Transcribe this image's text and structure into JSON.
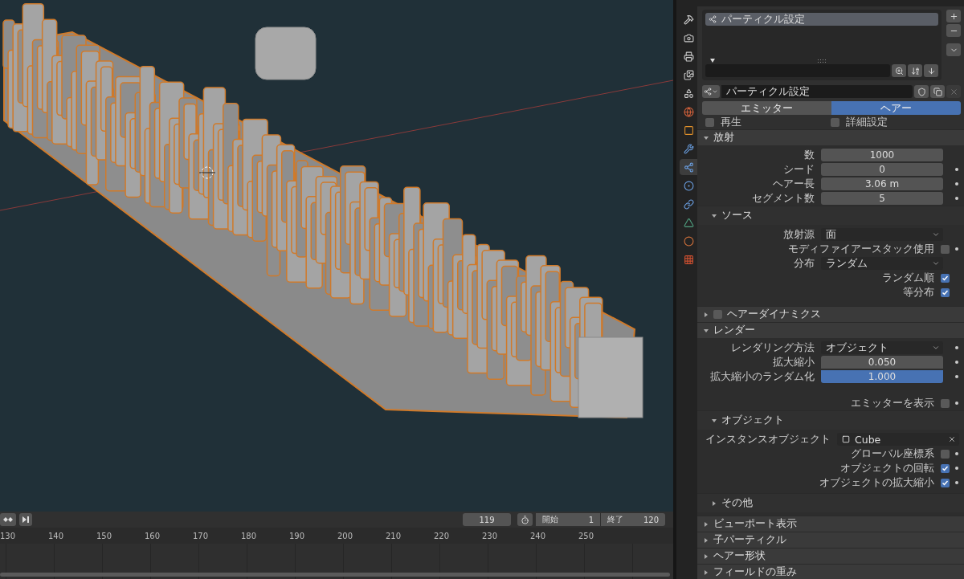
{
  "timeline": {
    "current_frame": "119",
    "start": {
      "label": "開始",
      "value": "1"
    },
    "end": {
      "label": "終了",
      "value": "120"
    },
    "ruler": [
      "130",
      "140",
      "150",
      "160",
      "170",
      "180",
      "190",
      "200",
      "210",
      "220",
      "230",
      "240",
      "250"
    ]
  },
  "properties_tabs": [
    {
      "kind": "tool",
      "selected": false
    },
    {
      "kind": "render",
      "selected": false
    },
    {
      "kind": "output",
      "selected": false
    },
    {
      "kind": "view_layer",
      "selected": false
    },
    {
      "kind": "scene",
      "selected": false
    },
    {
      "kind": "world",
      "selected": false
    },
    {
      "kind": "object",
      "selected": false
    },
    {
      "kind": "modifier",
      "selected": false
    },
    {
      "kind": "particles",
      "selected": true
    },
    {
      "kind": "physics",
      "selected": false
    },
    {
      "kind": "constraints",
      "selected": false
    },
    {
      "kind": "data",
      "selected": false
    },
    {
      "kind": "material",
      "selected": false
    },
    {
      "kind": "texture",
      "selected": false
    }
  ],
  "particle_list": {
    "items": [
      {
        "name": "パーティクル設定",
        "selected": true
      }
    ]
  },
  "datablock": {
    "name": "パーティクル設定"
  },
  "type_tabs": [
    {
      "label": "エミッター",
      "selected": false
    },
    {
      "label": "ヘアー",
      "selected": true
    }
  ],
  "toggles": [
    {
      "label": "再生",
      "checked": false
    },
    {
      "label": "詳細設定",
      "checked": false
    }
  ],
  "panels": [
    {
      "title": "放射",
      "expanded": true,
      "rows": [
        {
          "kind": "number",
          "label": "数",
          "value": "1000",
          "active": false,
          "animatable": false
        },
        {
          "kind": "number",
          "label": "シード",
          "value": "0",
          "active": false,
          "animatable": true
        },
        {
          "kind": "number",
          "label": "ヘアー長",
          "value": "3.06 m",
          "active": false,
          "animatable": true
        },
        {
          "kind": "number",
          "label": "セグメント数",
          "value": "5",
          "active": false,
          "animatable": true
        },
        {
          "kind": "subpanel",
          "title": "ソース",
          "expanded": true,
          "rows": [
            {
              "kind": "dropdown",
              "label": "放射源",
              "value": "面",
              "animatable": false
            },
            {
              "kind": "checkbox",
              "label": "モディファイアースタック使用",
              "checked": false,
              "animatable": true
            },
            {
              "kind": "dropdown",
              "label": "分布",
              "value": "ランダム",
              "animatable": false
            },
            {
              "kind": "checkbox",
              "label": "ランダム順",
              "checked": true,
              "animatable": false
            },
            {
              "kind": "checkbox",
              "label": "等分布",
              "checked": true,
              "animatable": false
            }
          ]
        }
      ]
    },
    {
      "title": "ヘアーダイナミクス",
      "expanded": false,
      "toggle": {
        "checked": false
      }
    },
    {
      "title": "レンダー",
      "expanded": true,
      "rows": [
        {
          "kind": "dropdown",
          "label": "レンダリング方法",
          "value": "オブジェクト",
          "animatable": true
        },
        {
          "kind": "number_group",
          "fields": [
            {
              "label": "拡大縮小",
              "value": "0.050",
              "active": false,
              "animatable": true
            },
            {
              "label": "拡大縮小のランダム化",
              "value": "1.000",
              "active": true,
              "animatable": true
            }
          ]
        },
        {
          "kind": "spacer"
        },
        {
          "kind": "checkbox",
          "label": "エミッターを表示",
          "checked": false,
          "animatable": true
        },
        {
          "kind": "subpanel",
          "title": "オブジェクト",
          "expanded": true,
          "rows": [
            {
              "kind": "object",
              "label": "インスタンスオブジェクト",
              "value": "Cube",
              "animatable": false
            },
            {
              "kind": "checkbox",
              "label": "グローバル座標系",
              "checked": false,
              "animatable": true
            },
            {
              "kind": "checkbox",
              "label": "オブジェクトの回転",
              "checked": true,
              "animatable": true
            },
            {
              "kind": "checkbox",
              "label": "オブジェクトの拡大縮小",
              "checked": true,
              "animatable": true
            }
          ]
        },
        {
          "kind": "subpanel",
          "title": "その他",
          "expanded": false
        }
      ]
    },
    {
      "title": "ビューポート表示",
      "expanded": false
    },
    {
      "title": "子パーティクル",
      "expanded": false
    },
    {
      "title": "ヘアー形状",
      "expanded": false
    },
    {
      "title": "フィールドの重み",
      "expanded": false
    }
  ]
}
